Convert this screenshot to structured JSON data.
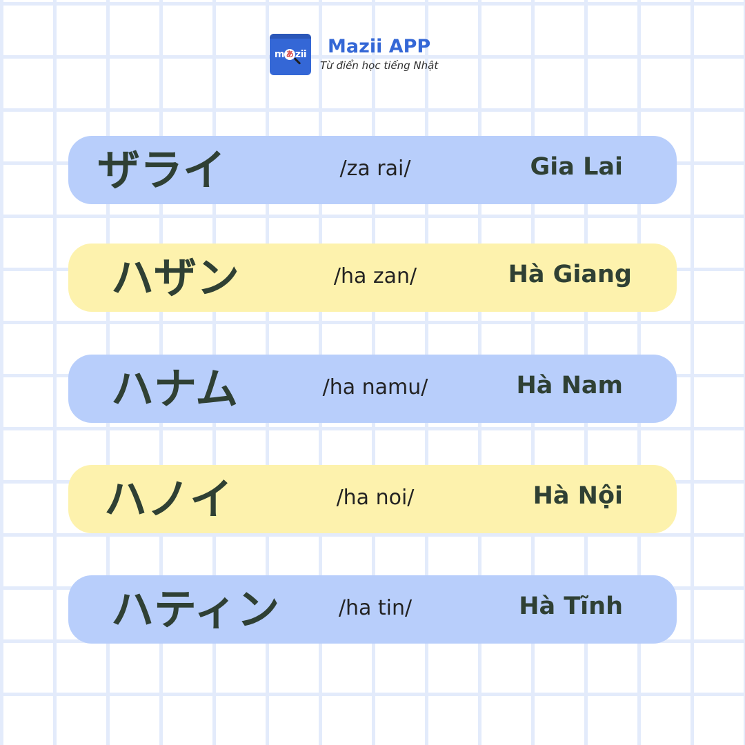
{
  "brand": {
    "logo_text_left": "m",
    "logo_glyph": "あ",
    "logo_text_right": "zii",
    "name": "Mazii APP",
    "tagline": "Từ điển học tiếng Nhật"
  },
  "colors": {
    "row_blue": "#b8cefb",
    "row_yellow": "#fdf2ad",
    "text_dark_green": "#2f4034",
    "brand_blue": "#3467d6",
    "grid_line": "#e3ebfb"
  },
  "rows": [
    {
      "kana": "ザライ",
      "romaji": "/za rai/",
      "place": "Gia Lai",
      "color": "blue"
    },
    {
      "kana": "ハザン",
      "romaji": "/ha zan/",
      "place": "Hà Giang",
      "color": "yellow"
    },
    {
      "kana": "ハナム",
      "romaji": "/ha namu/",
      "place": "Hà Nam",
      "color": "blue"
    },
    {
      "kana": "ハノイ",
      "romaji": "/ha noi/",
      "place": "Hà Nội",
      "color": "yellow"
    },
    {
      "kana": "ハティン",
      "romaji": "/ha tin/",
      "place": "Hà Tĩnh",
      "color": "blue"
    }
  ]
}
